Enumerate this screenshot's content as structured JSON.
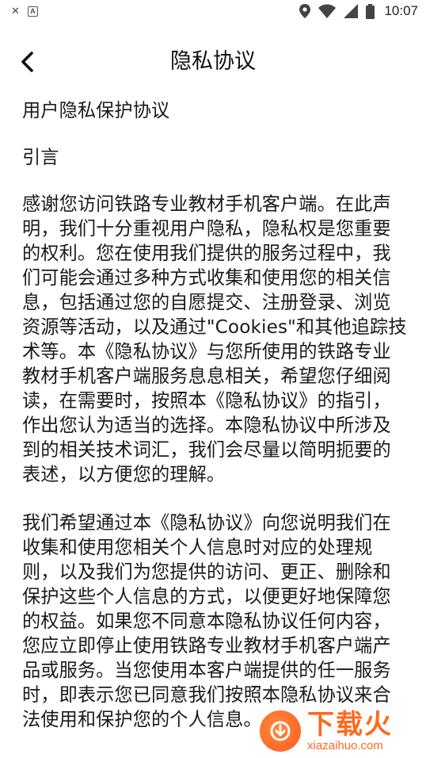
{
  "status_bar": {
    "time": "10:07",
    "left_icons": [
      "close-icon",
      "a-box-icon"
    ],
    "right_icons": [
      "location-icon",
      "wifi-icon",
      "signal-icon",
      "battery-icon"
    ]
  },
  "header": {
    "title": "隐私协议",
    "back_icon": "chevron-left-icon"
  },
  "content": {
    "heading": "用户隐私保护协议",
    "section_title": "引言",
    "paragraph_1": "感谢您访问铁路专业教材手机客户端。在此声明，我们十分重视用户隐私，隐私权是您重要的权利。您在使用我们提供的服务过程中，我们可能会通过多种方式收集和使用您的相关信息，包括通过您的自愿提交、注册登录、浏览资源等活动，以及通过\"Cookies\"和其他追踪技术等。本《隐私协议》与您所使用的铁路专业教材手机客户端服务息息相关，希望您仔细阅读，在需要时，按照本《隐私协议》的指引，作出您认为适当的选择。本隐私协议中所涉及到的相关技术词汇，我们会尽量以简明扼要的表述，以方便您的理解。",
    "paragraph_2": "我们希望通过本《隐私协议》向您说明我们在收集和使用您相关个人信息时对应的处理规则，以及我们为您提供的访问、更正、删除和保护这些个人信息的方式，以便更好地保障您的权益。如果您不同意本隐私协议任何内容，您应立即停止使用铁路专业教材手机客户端产品或服务。当您使用本客户端提供的任一服务时，即表示您已同意我们按照本隐私协议来合法使用和保护您的个人信息。"
  },
  "watermark": {
    "title": "下载火",
    "url": "xiazaihuo.com",
    "color": "#ff6a1f"
  }
}
